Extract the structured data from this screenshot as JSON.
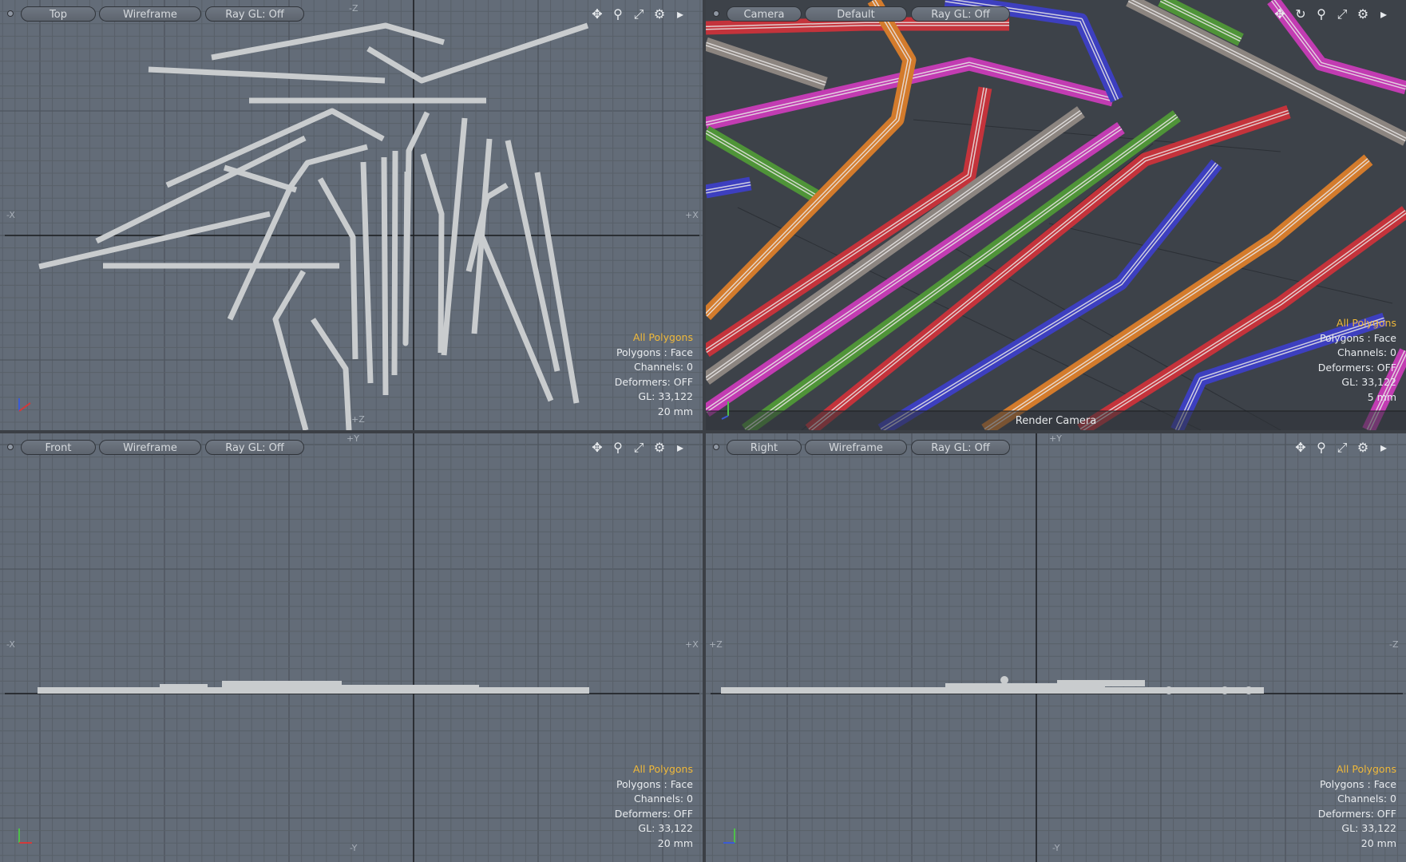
{
  "viewports": [
    {
      "id": "top",
      "view_label": "Top",
      "shading_label": "Wireframe",
      "raygl_label": "Ray GL: Off",
      "axes": {
        "left": "-X",
        "right": "+X",
        "top": "-Z",
        "bottom": "+Z"
      },
      "tools": [
        "move-icon",
        "zoom-icon",
        "maximize-icon",
        "gear-icon",
        "arrow-right-icon"
      ],
      "info": {
        "selection": "All Polygons",
        "polygons": "Polygons : Face",
        "channels": "Channels: 0",
        "deformers": "Deformers: OFF",
        "gl": "GL: 33,122",
        "scale": "20 mm"
      }
    },
    {
      "id": "camera",
      "view_label": "Camera",
      "shading_label": "Default",
      "raygl_label": "Ray GL: Off",
      "tools": [
        "move-icon",
        "rotate-icon",
        "zoom-icon",
        "maximize-icon",
        "gear-icon",
        "arrow-right-icon"
      ],
      "info": {
        "selection": "All Polygons",
        "polygons": "Polygons : Face",
        "channels": "Channels: 0",
        "deformers": "Deformers: OFF",
        "gl": "GL: 33,122",
        "scale": "5 mm"
      },
      "camera_name": "Render Camera"
    },
    {
      "id": "front",
      "view_label": "Front",
      "shading_label": "Wireframe",
      "raygl_label": "Ray GL: Off",
      "axes": {
        "left": "-X",
        "right": "+X",
        "top": "+Y",
        "bottom": "-Y"
      },
      "tools": [
        "move-icon",
        "zoom-icon",
        "maximize-icon",
        "gear-icon",
        "arrow-right-icon"
      ],
      "info": {
        "selection": "All Polygons",
        "polygons": "Polygons : Face",
        "channels": "Channels: 0",
        "deformers": "Deformers: OFF",
        "gl": "GL: 33,122",
        "scale": "20 mm"
      }
    },
    {
      "id": "right",
      "view_label": "Right",
      "shading_label": "Wireframe",
      "raygl_label": "Ray GL: Off",
      "axes": {
        "left": "+Z",
        "right": "-Z",
        "top": "+Y",
        "bottom": "-Y"
      },
      "tools": [
        "move-icon",
        "zoom-icon",
        "maximize-icon",
        "gear-icon",
        "arrow-right-icon"
      ],
      "info": {
        "selection": "All Polygons",
        "polygons": "Polygons : Face",
        "channels": "Channels: 0",
        "deformers": "Deformers: OFF",
        "gl": "GL: 33,122",
        "scale": "20 mm"
      }
    }
  ],
  "colors": {
    "viewport_bg": "#636c78",
    "grid_minor": "#586069",
    "grid_major": "#4e555e",
    "axis_line": "#1b1d20",
    "straw_wire": "#c9ccce",
    "camera_bg": "#3d4249",
    "info_highlight": "#f0b93a",
    "straw_colors": [
      "#c4333b",
      "#d37b2c",
      "#3d3fbf",
      "#c23cb2",
      "#4f9438",
      "#8c8580"
    ]
  }
}
